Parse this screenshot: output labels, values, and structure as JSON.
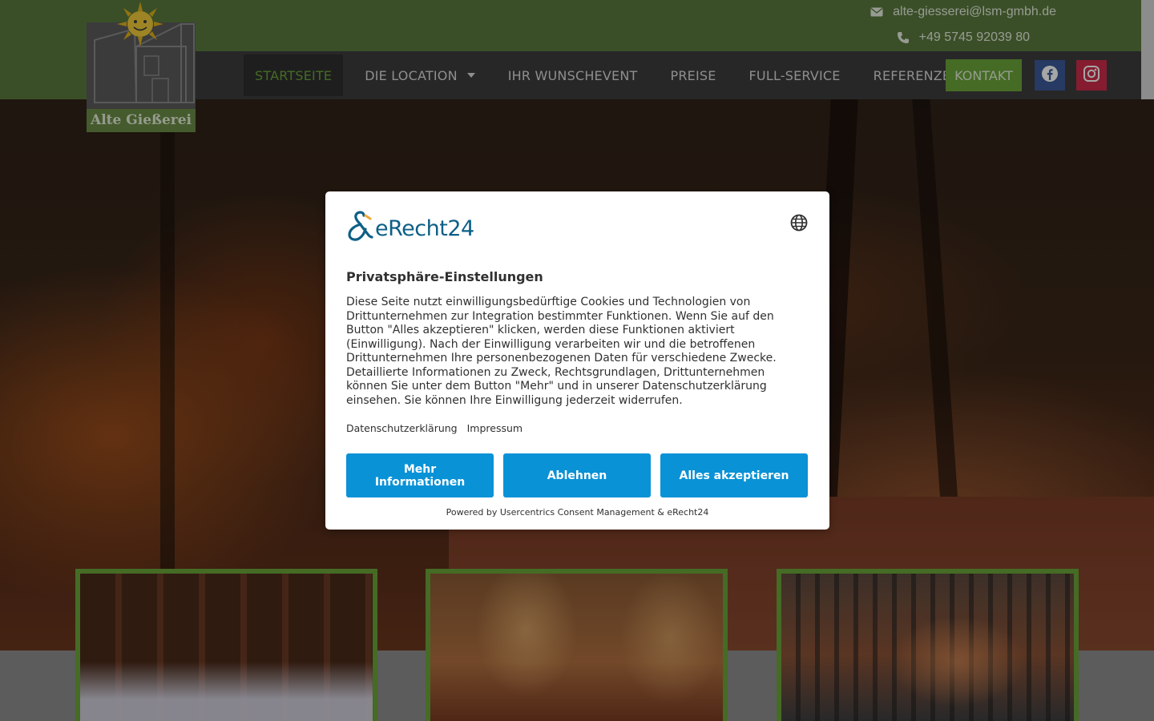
{
  "header": {
    "email": "alte-giesserei@lsm-gmbh.de",
    "phone": "+49 5745 92039 80",
    "logo_text": "Alte Gießerei",
    "nav": [
      {
        "label": "STARTSEITE",
        "active": true
      },
      {
        "label": "DIE LOCATION",
        "has_dropdown": true
      },
      {
        "label": "IHR WUNSCHEVENT"
      },
      {
        "label": "PREISE"
      },
      {
        "label": "FULL-SERVICE"
      },
      {
        "label": "REFERENZEN"
      }
    ],
    "kontakt_label": "KONTAKT",
    "social": [
      "facebook-icon",
      "instagram-icon"
    ]
  },
  "consent": {
    "brand": "eRecht24",
    "title": "Privatsphäre-Einstellungen",
    "body": "Diese Seite nutzt einwilligungsbedürftige Cookies und Technologien von Drittunternehmen zur Integration bestimmter Funktionen. Wenn Sie auf den Button \"Alles akzeptieren\" klicken, werden diese Funktionen aktiviert (Einwilligung). Nach der Einwilligung verarbeiten wir und die betroffenen Drittunternehmen Ihre personenbezogenen Daten für verschiedene Zwecke. Detaillierte Informationen zu Zweck, Rechtsgrundlagen, Drittunternehmen können Sie unter dem Button \"Mehr\" und in unserer Datenschutzerklärung einsehen. Sie können Ihre Einwilligung jederzeit widerrufen.",
    "link_privacy": "Datenschutzerklärung",
    "link_imprint": "Impressum",
    "btn_more": "Mehr Informationen",
    "btn_deny": "Ablehnen",
    "btn_accept": "Alles akzeptieren",
    "powered_by": "Powered by Usercentrics Consent Management & eRecht24"
  },
  "colors": {
    "brand_green": "#5a7a3c",
    "accent_green": "#6aa53a",
    "nav_dark": "#3d3d3d",
    "consent_button": "#0a92d6",
    "erecht_blue": "#0d5f86"
  }
}
